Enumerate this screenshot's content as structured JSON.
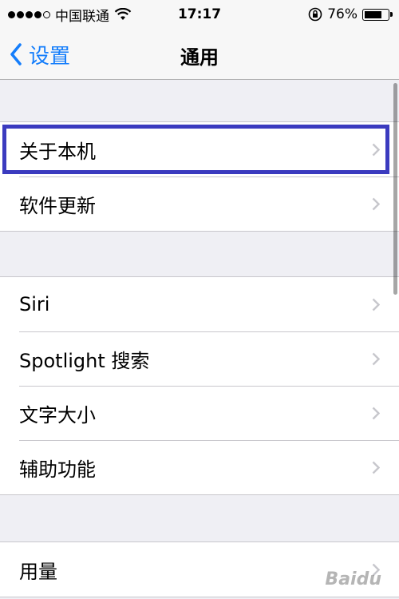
{
  "status_bar": {
    "carrier": "中国联通",
    "time": "17:17",
    "battery_percent": "76%",
    "battery_level": 0.76,
    "signal_dots_filled": 4,
    "signal_dots_total": 5
  },
  "nav": {
    "back_label": "设置",
    "title": "通用"
  },
  "groups": [
    {
      "rows": [
        {
          "label": "关于本机",
          "highlighted": true
        },
        {
          "label": "软件更新"
        }
      ]
    },
    {
      "rows": [
        {
          "label": "Siri"
        },
        {
          "label": "Spotlight 搜索"
        },
        {
          "label": "文字大小"
        },
        {
          "label": "辅助功能"
        }
      ]
    },
    {
      "rows": [
        {
          "label": "用量"
        }
      ]
    }
  ],
  "watermark": "Baidu",
  "colors": {
    "accent": "#157efb",
    "highlight_border": "#3b3bbf",
    "background": "#efeff4"
  }
}
